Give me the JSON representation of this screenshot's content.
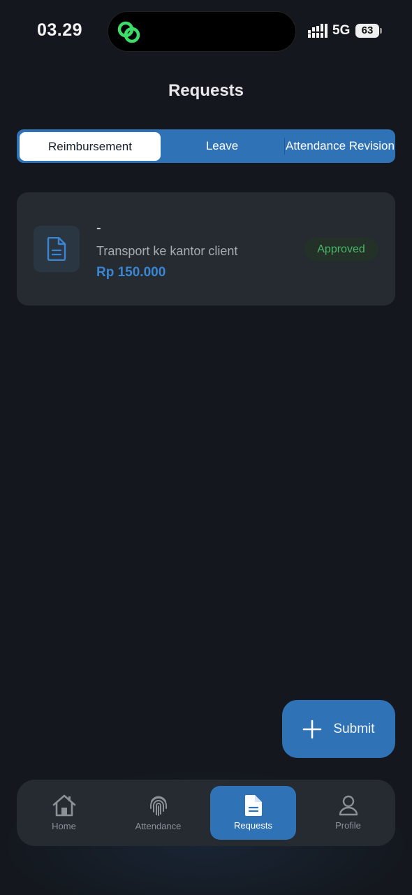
{
  "status_bar": {
    "time": "03.29",
    "network": "5G",
    "battery": "63"
  },
  "page": {
    "title": "Requests"
  },
  "tabs": [
    {
      "label": "Reimbursement",
      "active": true
    },
    {
      "label": "Leave",
      "active": false
    },
    {
      "label": "Attendance Revision",
      "active": false
    }
  ],
  "requests": [
    {
      "title": "-",
      "description": "Transport ke kantor client",
      "amount": "Rp 150.000",
      "status": "Approved",
      "icon": "document-icon"
    }
  ],
  "fab": {
    "label": "Submit",
    "icon": "plus-icon"
  },
  "nav": [
    {
      "label": "Home",
      "icon": "home-icon"
    },
    {
      "label": "Attendance",
      "icon": "fingerprint-icon"
    },
    {
      "label": "Requests",
      "icon": "document-icon",
      "active": true
    },
    {
      "label": "Profile",
      "icon": "person-icon"
    }
  ],
  "colors": {
    "accent": "#2f72b6",
    "background": "#14181e",
    "card": "#262a31",
    "approved": "#4bb567",
    "amount": "#3a86d3"
  }
}
